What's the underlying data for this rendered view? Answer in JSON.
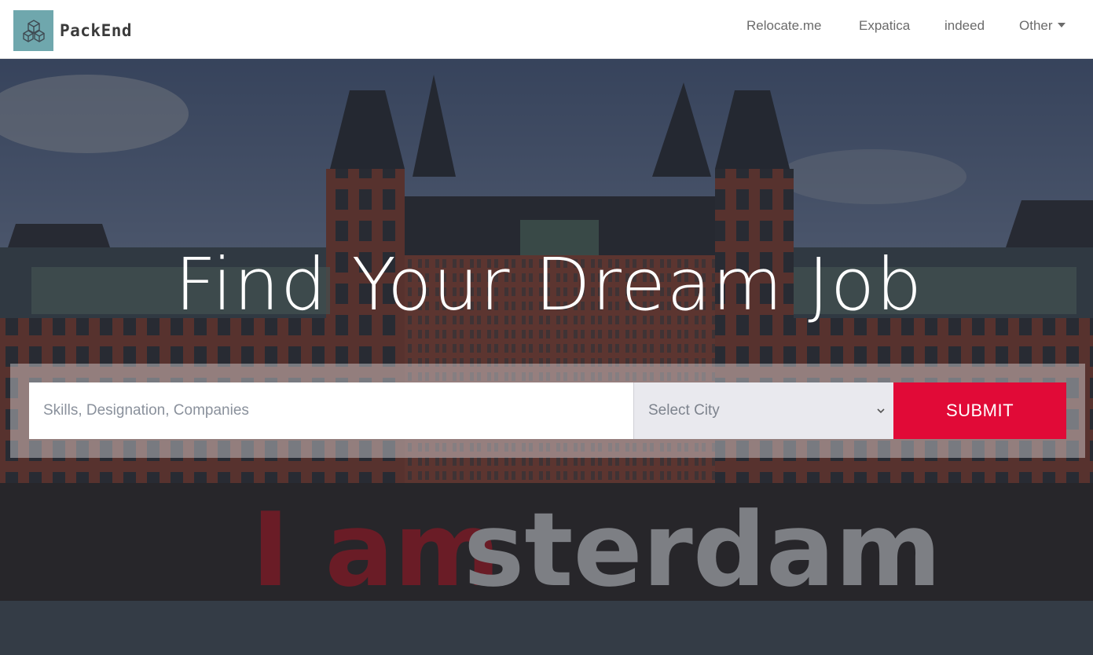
{
  "brand": {
    "name": "PackEnd",
    "logo_icon": "cubes-icon",
    "logo_color": "#6fa7ad"
  },
  "nav": {
    "items": [
      {
        "label": "Relocate.me"
      },
      {
        "label": "Expatica"
      },
      {
        "label": "indeed"
      },
      {
        "label": "Other",
        "has_dropdown": true,
        "icon": "caret-down-icon"
      }
    ]
  },
  "hero": {
    "headline": "Find Your Dream Job",
    "background": "photo of Rijksmuseum Amsterdam with I amsterdam letters",
    "search": {
      "placeholder": "Skills, Designation, Companies",
      "value": "",
      "city_select": {
        "selected": "Select City",
        "icon": "chevron-down-icon"
      },
      "submit_label": "SUBMIT"
    }
  },
  "colors": {
    "accent": "#e10a37",
    "header_bg": "#ffffff",
    "nav_text": "#6b6b6b"
  }
}
